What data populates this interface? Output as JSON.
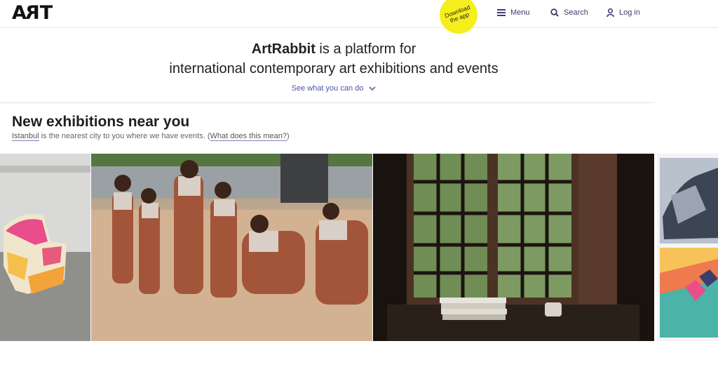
{
  "header": {
    "logo_text": "ART",
    "download_badge": "Download the app",
    "nav": {
      "menu": "Menu",
      "search": "Search",
      "login": "Log in"
    }
  },
  "hero": {
    "brand": "ArtRabbit",
    "line1_rest": " is a platform for",
    "line2": "international contemporary art exhibitions and events",
    "see_what": "See what you can do"
  },
  "section": {
    "title": "New exhibitions near you",
    "city": "Istanbul",
    "sub_middle": " is the nearest city to you where we have events. (",
    "what_link": "What does this mean?",
    "sub_end": ")"
  },
  "gallery": [
    {
      "name": "exhibition-image-sculpture"
    },
    {
      "name": "exhibition-image-children"
    },
    {
      "name": "exhibition-image-window"
    },
    {
      "name": "exhibition-image-painting"
    }
  ],
  "colors": {
    "accent": "#4d53a8",
    "nav": "#3a3f6b",
    "badge": "#f5ef1e"
  }
}
